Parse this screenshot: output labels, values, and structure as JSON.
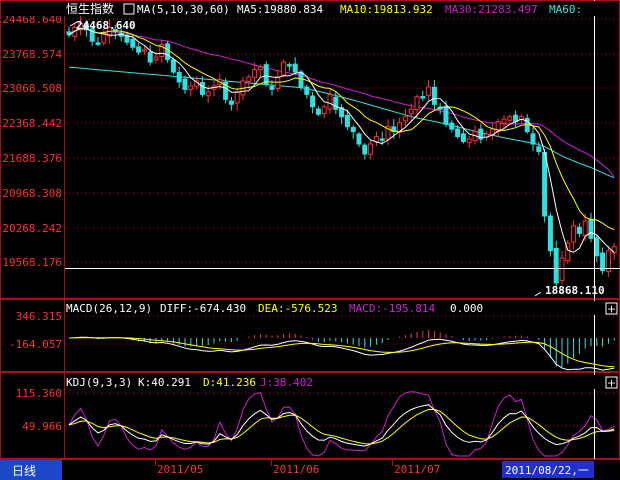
{
  "header": {
    "title": "恒生指数",
    "ma_label": "MA(5,10,30,60)",
    "ma5": "MA5:19880.834",
    "ma10": "MA10:19813.932",
    "ma30": "MA30:21283.497",
    "ma60": "MA60:"
  },
  "colors": {
    "ma5": "#ffffff",
    "ma10": "#ffff00",
    "ma30": "#d020d0",
    "ma60": "#40e0e0",
    "up": "#ff3030",
    "down": "#30e0e0",
    "grid": "#aa1010"
  },
  "price_panel": {
    "y_ticks": [
      "24468.640",
      "23768.574",
      "23068.508",
      "22368.442",
      "21688.376",
      "20968.308",
      "20268.242",
      "19568.176"
    ],
    "high_label": "24468.640",
    "low_label": "18868.110"
  },
  "macd_panel": {
    "header": "MACD(26,12,9)",
    "diff": "DIFF:-674.430",
    "dea": "DEA:-576.523",
    "macd": "MACD:-195.814",
    "extra": "0.000",
    "y_ticks": [
      "346.315",
      "-164.057"
    ]
  },
  "kdj_panel": {
    "header": "KDJ(9,3,3)",
    "k": "K:40.291",
    "d": "D:41.236",
    "j": "J:38.402",
    "y_ticks": [
      "115.360",
      "49.966"
    ]
  },
  "footer": {
    "period_button": "日线",
    "dates": [
      "2011/05",
      "2011/06",
      "2011/07"
    ],
    "cursor_date": "2011/08/22,一"
  },
  "chart_data": {
    "type": "candlestick",
    "title": "恒生指数",
    "period": "daily",
    "date_range": [
      "2011-04-08",
      "2011-08-24"
    ],
    "ylim_price": [
      18868.11,
      24468.64
    ],
    "max_price": 24468.64,
    "min_price": 18868.11,
    "closes": [
      24150,
      24300,
      24380,
      24250,
      24020,
      23980,
      24180,
      24300,
      24220,
      24120,
      24000,
      23900,
      23800,
      23850,
      23600,
      23700,
      23950,
      23650,
      23400,
      23200,
      23050,
      23120,
      23220,
      22950,
      23000,
      23120,
      23250,
      22850,
      22750,
      23000,
      23220,
      23300,
      23450,
      23500,
      23150,
      23050,
      23300,
      23600,
      23520,
      23400,
      23100,
      22950,
      22700,
      22550,
      22700,
      22950,
      22650,
      22500,
      22300,
      22200,
      21950,
      21750,
      21950,
      22100,
      22050,
      22300,
      22200,
      22380,
      22500,
      22650,
      22900,
      22900,
      23100,
      22750,
      22650,
      22350,
      22250,
      22100,
      22000,
      22050,
      22200,
      22050,
      22150,
      22250,
      22400,
      22450,
      22500,
      22400,
      22500,
      22200,
      21950,
      21800,
      20500,
      19800,
      19150,
      19650,
      19950,
      20300,
      20150,
      20400,
      20050,
      19700,
      19400,
      19800,
      19880
    ],
    "ma5": [
      24150,
      24225,
      24277,
      24270,
      24220,
      24186,
      24166,
      24146,
      24140,
      24164,
      24128,
      24108,
      24008,
      23934,
      23830,
      23770,
      23780,
      23750,
      23660,
      23580,
      23450,
      23284,
      23198,
      23108,
      23068,
      23088,
      23108,
      23078,
      22994,
      22994,
      23014,
      23024,
      23144,
      23294,
      23324,
      23300,
      23290,
      23324,
      23324,
      23374,
      23394,
      23314,
      23134,
      22940,
      22800,
      22770,
      22710,
      22670,
      22620,
      22460,
      22320,
      22150,
      22030,
      21990,
      21960,
      22030,
      22120,
      22206,
      22286,
      22406,
      22526,
      22666,
      22810,
      22870,
      22860,
      22750,
      22620,
      22420,
      22270,
      22150,
      22120,
      22080,
      22090,
      22130,
      22210,
      22260,
      22350,
      22400,
      22450,
      22410,
      22310,
      22170,
      21790,
      21250,
      20640,
      20180,
      19810,
      19770,
      19850,
      20090,
      20170,
      20120,
      19990,
      19870,
      19766
    ],
    "ma10": [
      24150,
      24225,
      24277,
      24270,
      24220,
      24186,
      24196,
      24223,
      24228,
      24220,
      24197,
      24157,
      24099,
      24059,
      23997,
      23937,
      23914,
      23854,
      23772,
      23680,
      23585,
      23507,
      23449,
      23382,
      23324,
      23266,
      23200,
      23140,
      23074,
      23054,
      23072,
      23090,
      23111,
      23166,
      23207,
      23200,
      23196,
      23206,
      23233,
      23280,
      23268,
      23234,
      23179,
      23117,
      23081,
      23071,
      23006,
      22901,
      22779,
      22699,
      22624,
      22504,
      22429,
      22385,
      22320,
      22255,
      22210,
      22198,
      22218,
      22236,
      22331,
      22446,
      22561,
      22626,
      22686,
      22691,
      22696,
      22668,
      22618,
      22558,
      22488,
      22403,
      22308,
      22258,
      22233,
      22223,
      22248,
      22278,
      22328,
      22343,
      22318,
      22293,
      22128,
      21898,
      21565,
      21285,
      21055,
      20845,
      20610,
      20475,
      20430,
      20420,
      20355,
      20275,
      20223
    ],
    "ma30": [
      24150,
      24225,
      24277,
      24270,
      24220,
      24186,
      24186,
      24200,
      24202,
      24194,
      24176,
      24153,
      24125,
      24104,
      24070,
      24048,
      24043,
      24024,
      23991,
      23952,
      23909,
      23873,
      23845,
      23806,
      23772,
      23745,
      23726,
      23693,
      23659,
      23637,
      23606,
      23573,
      23542,
      23514,
      23484,
      23456,
      23427,
      23404,
      23381,
      23358,
      23328,
      23297,
      23260,
      23218,
      23187,
      23163,
      23128,
      23090,
      23058,
      23025,
      22994,
      22959,
      22920,
      22888,
      22865,
      22839,
      22803,
      22775,
      22746,
      22719,
      22694,
      22681,
      22668,
      22641,
      22617,
      22592,
      22565,
      22531,
      22496,
      22463,
      22436,
      22408,
      22389,
      22376,
      22366,
      22356,
      22351,
      22354,
      22359,
      22364,
      22363,
      22351,
      22290,
      22208,
      22112,
      22027,
      21952,
      21890,
      21827,
      21773,
      21707,
      21625,
      21531,
      21437,
      21283
    ],
    "ma60": [
      23500,
      23489,
      23479,
      23469,
      23458,
      23448,
      23438,
      23427,
      23417,
      23406,
      23396,
      23386,
      23375,
      23365,
      23355,
      23344,
      23334,
      23324,
      23313,
      23303,
      23293,
      23282,
      23272,
      23261,
      23251,
      23241,
      23230,
      23220,
      23210,
      23199,
      23189,
      23179,
      23168,
      23158,
      23148,
      23137,
      23127,
      23116,
      23106,
      23096,
      23085,
      23063,
      23039,
      23013,
      22986,
      22958,
      22928,
      22898,
      22866,
      22834,
      22802,
      22768,
      22735,
      22701,
      22667,
      22634,
      22601,
      22568,
      22536,
      22505,
      22474,
      22450,
      22427,
      22403,
      22377,
      22351,
      22323,
      22295,
      22266,
      22237,
      22208,
      22180,
      22153,
      22127,
      22102,
      22077,
      22053,
      22032,
      22010,
      21989,
      21965,
      21941,
      21896,
      21839,
      21772,
      21711,
      21656,
      21609,
      21561,
      21519,
      21474,
      21424,
      21370,
      21319,
      21270
    ],
    "macd": {
      "params": [
        26,
        12,
        9
      ],
      "diff": -674.43,
      "dea": -576.523,
      "macd": -195.814,
      "ylim": [
        -400,
        346.315
      ]
    },
    "kdj": {
      "params": [
        9,
        3,
        3
      ],
      "k": 40.291,
      "d": 41.236,
      "j": 38.402,
      "ylim": [
        0,
        115.36
      ]
    }
  }
}
